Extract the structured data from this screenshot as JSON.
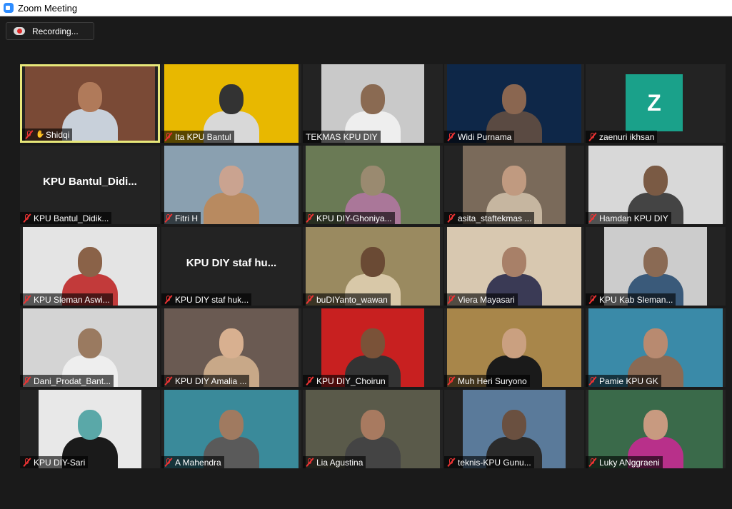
{
  "window": {
    "title": "Zoom Meeting"
  },
  "recording": {
    "label": "Recording..."
  },
  "participants": [
    {
      "name": "Shidqi",
      "muted": true,
      "bg": "#7a4a36",
      "skin": "#b07a5a",
      "shirt": "#c8d0da"
    },
    {
      "name": "Ita KPU Bantul",
      "muted": true,
      "bg": "#e8b800",
      "skin": "#333333",
      "shirt": "#d8d8d8"
    },
    {
      "name": "TEKMAS KPU DIY",
      "muted": false,
      "bg": "#c9c9c9",
      "skin": "#8a6a52",
      "shirt": "#eeeeee"
    },
    {
      "name": "Widi Purnama",
      "muted": true,
      "bg": "#0e2748",
      "skin": "#8a6650",
      "shirt": "#5a4a42"
    },
    {
      "name": "zaenuri ikhsan",
      "muted": true,
      "initial": "Z",
      "bg": "#232323",
      "avatar_color": "#1aa18a"
    },
    {
      "name": "KPU Bantul_Didik...",
      "muted": true,
      "big": "KPU  Bantul_Didi...",
      "bg": "#232323"
    },
    {
      "name": "Fitri H",
      "muted": true,
      "bg": "#8aa0b0",
      "skin": "#caa390",
      "shirt": "#b88a60"
    },
    {
      "name": "KPU DIY-Ghoniya...",
      "muted": true,
      "bg": "#6a7a55",
      "skin": "#9a8a70",
      "shirt": "#aa7799"
    },
    {
      "name": "asita_staftekmas ...",
      "muted": true,
      "bg": "#7a6a5a",
      "skin": "#c09a80",
      "shirt": "#c6b6a0"
    },
    {
      "name": "Hamdan KPU DIY",
      "muted": true,
      "bg": "#d8d8d8",
      "skin": "#7a5a44",
      "shirt": "#444444"
    },
    {
      "name": "KPU Sleman Aswi...",
      "muted": true,
      "bg": "#e4e4e4",
      "skin": "#8a6248",
      "shirt": "#c23a3a"
    },
    {
      "name": "KPU DIY staf huk...",
      "muted": true,
      "big": "KPU DIY staf hu...",
      "bg": "#232323"
    },
    {
      "name": "buDIYanto_wawan",
      "muted": true,
      "bg": "#9a8a60",
      "skin": "#6a4a34",
      "shirt": "#d8c8a8"
    },
    {
      "name": "Viera Mayasari",
      "muted": true,
      "bg": "#d8c8b0",
      "skin": "#a88068",
      "shirt": "#3a3a55"
    },
    {
      "name": "KPU Kab Sleman...",
      "muted": true,
      "bg": "#cccccc",
      "skin": "#8a6a54",
      "shirt": "#3a5a7a"
    },
    {
      "name": "Dani_Prodat_Bant...",
      "muted": true,
      "bg": "#d4d4d4",
      "skin": "#9a7a60",
      "shirt": "#eeeeee"
    },
    {
      "name": "KPU DIY Amalia ...",
      "muted": true,
      "bg": "#6a5a52",
      "skin": "#d8b090",
      "shirt": "#c8a888"
    },
    {
      "name": "KPU DIY_Choirun",
      "muted": true,
      "bg": "#c82020",
      "skin": "#7a5238",
      "shirt": "#333333"
    },
    {
      "name": "Muh Heri Suryono",
      "muted": true,
      "bg": "#a8864a",
      "skin": "#caa080",
      "shirt": "#1a1a1a"
    },
    {
      "name": "Pamie KPU GK",
      "muted": true,
      "bg": "#3a8aa8",
      "skin": "#b88a70",
      "shirt": "#8a6a54"
    },
    {
      "name": "KPU DIY-Sari",
      "muted": true,
      "bg": "#e8e8e8",
      "skin": "#5aa8a8",
      "shirt": "#1a1a1a"
    },
    {
      "name": "A Mahendra",
      "muted": true,
      "bg": "#3a8a9a",
      "skin": "#a07a60",
      "shirt": "#5a5a5a"
    },
    {
      "name": "Lia Agustina",
      "muted": true,
      "bg": "#5a5a4a",
      "skin": "#a87a60",
      "shirt": "#444444"
    },
    {
      "name": "teknis-KPU Gunu...",
      "muted": true,
      "bg": "#5a7a9a",
      "skin": "#6a5040",
      "shirt": "#2a2a2a"
    },
    {
      "name": "Luky ANggraeni",
      "muted": true,
      "bg": "#3a6a4a",
      "skin": "#c89a80",
      "shirt": "#b8308a"
    }
  ]
}
